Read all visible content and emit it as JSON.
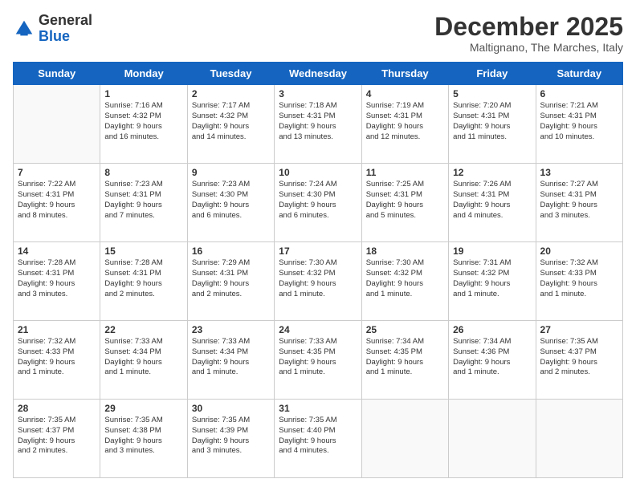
{
  "header": {
    "logo": {
      "general": "General",
      "blue": "Blue"
    },
    "title": "December 2025",
    "location": "Maltignano, The Marches, Italy"
  },
  "calendar": {
    "days_of_week": [
      "Sunday",
      "Monday",
      "Tuesday",
      "Wednesday",
      "Thursday",
      "Friday",
      "Saturday"
    ],
    "weeks": [
      [
        {
          "day": "",
          "info": ""
        },
        {
          "day": "1",
          "info": "Sunrise: 7:16 AM\nSunset: 4:32 PM\nDaylight: 9 hours\nand 16 minutes."
        },
        {
          "day": "2",
          "info": "Sunrise: 7:17 AM\nSunset: 4:32 PM\nDaylight: 9 hours\nand 14 minutes."
        },
        {
          "day": "3",
          "info": "Sunrise: 7:18 AM\nSunset: 4:31 PM\nDaylight: 9 hours\nand 13 minutes."
        },
        {
          "day": "4",
          "info": "Sunrise: 7:19 AM\nSunset: 4:31 PM\nDaylight: 9 hours\nand 12 minutes."
        },
        {
          "day": "5",
          "info": "Sunrise: 7:20 AM\nSunset: 4:31 PM\nDaylight: 9 hours\nand 11 minutes."
        },
        {
          "day": "6",
          "info": "Sunrise: 7:21 AM\nSunset: 4:31 PM\nDaylight: 9 hours\nand 10 minutes."
        }
      ],
      [
        {
          "day": "7",
          "info": "Sunrise: 7:22 AM\nSunset: 4:31 PM\nDaylight: 9 hours\nand 8 minutes."
        },
        {
          "day": "8",
          "info": "Sunrise: 7:23 AM\nSunset: 4:31 PM\nDaylight: 9 hours\nand 7 minutes."
        },
        {
          "day": "9",
          "info": "Sunrise: 7:23 AM\nSunset: 4:30 PM\nDaylight: 9 hours\nand 6 minutes."
        },
        {
          "day": "10",
          "info": "Sunrise: 7:24 AM\nSunset: 4:30 PM\nDaylight: 9 hours\nand 6 minutes."
        },
        {
          "day": "11",
          "info": "Sunrise: 7:25 AM\nSunset: 4:31 PM\nDaylight: 9 hours\nand 5 minutes."
        },
        {
          "day": "12",
          "info": "Sunrise: 7:26 AM\nSunset: 4:31 PM\nDaylight: 9 hours\nand 4 minutes."
        },
        {
          "day": "13",
          "info": "Sunrise: 7:27 AM\nSunset: 4:31 PM\nDaylight: 9 hours\nand 3 minutes."
        }
      ],
      [
        {
          "day": "14",
          "info": "Sunrise: 7:28 AM\nSunset: 4:31 PM\nDaylight: 9 hours\nand 3 minutes."
        },
        {
          "day": "15",
          "info": "Sunrise: 7:28 AM\nSunset: 4:31 PM\nDaylight: 9 hours\nand 2 minutes."
        },
        {
          "day": "16",
          "info": "Sunrise: 7:29 AM\nSunset: 4:31 PM\nDaylight: 9 hours\nand 2 minutes."
        },
        {
          "day": "17",
          "info": "Sunrise: 7:30 AM\nSunset: 4:32 PM\nDaylight: 9 hours\nand 1 minute."
        },
        {
          "day": "18",
          "info": "Sunrise: 7:30 AM\nSunset: 4:32 PM\nDaylight: 9 hours\nand 1 minute."
        },
        {
          "day": "19",
          "info": "Sunrise: 7:31 AM\nSunset: 4:32 PM\nDaylight: 9 hours\nand 1 minute."
        },
        {
          "day": "20",
          "info": "Sunrise: 7:32 AM\nSunset: 4:33 PM\nDaylight: 9 hours\nand 1 minute."
        }
      ],
      [
        {
          "day": "21",
          "info": "Sunrise: 7:32 AM\nSunset: 4:33 PM\nDaylight: 9 hours\nand 1 minute."
        },
        {
          "day": "22",
          "info": "Sunrise: 7:33 AM\nSunset: 4:34 PM\nDaylight: 9 hours\nand 1 minute."
        },
        {
          "day": "23",
          "info": "Sunrise: 7:33 AM\nSunset: 4:34 PM\nDaylight: 9 hours\nand 1 minute."
        },
        {
          "day": "24",
          "info": "Sunrise: 7:33 AM\nSunset: 4:35 PM\nDaylight: 9 hours\nand 1 minute."
        },
        {
          "day": "25",
          "info": "Sunrise: 7:34 AM\nSunset: 4:35 PM\nDaylight: 9 hours\nand 1 minute."
        },
        {
          "day": "26",
          "info": "Sunrise: 7:34 AM\nSunset: 4:36 PM\nDaylight: 9 hours\nand 1 minute."
        },
        {
          "day": "27",
          "info": "Sunrise: 7:35 AM\nSunset: 4:37 PM\nDaylight: 9 hours\nand 2 minutes."
        }
      ],
      [
        {
          "day": "28",
          "info": "Sunrise: 7:35 AM\nSunset: 4:37 PM\nDaylight: 9 hours\nand 2 minutes."
        },
        {
          "day": "29",
          "info": "Sunrise: 7:35 AM\nSunset: 4:38 PM\nDaylight: 9 hours\nand 3 minutes."
        },
        {
          "day": "30",
          "info": "Sunrise: 7:35 AM\nSunset: 4:39 PM\nDaylight: 9 hours\nand 3 minutes."
        },
        {
          "day": "31",
          "info": "Sunrise: 7:35 AM\nSunset: 4:40 PM\nDaylight: 9 hours\nand 4 minutes."
        },
        {
          "day": "",
          "info": ""
        },
        {
          "day": "",
          "info": ""
        },
        {
          "day": "",
          "info": ""
        }
      ]
    ]
  }
}
